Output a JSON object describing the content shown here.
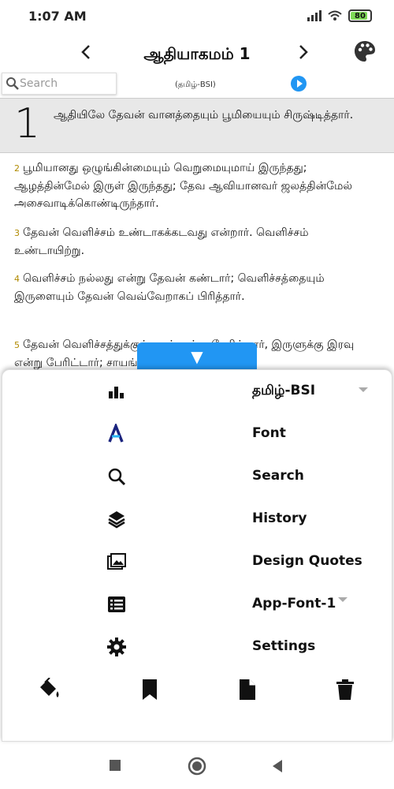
{
  "status": {
    "time": "1:07 AM",
    "battery": "80"
  },
  "header": {
    "title": "ஆதியாகமம் 1",
    "prev_icon": "chevron-left-icon",
    "next_icon": "chevron-right-icon",
    "palette_icon": "palette-icon"
  },
  "search": {
    "placeholder": "Search"
  },
  "version_label": "(தமிழ்-BSI)",
  "chapter_number": "1",
  "verses": [
    {
      "num": "",
      "text": "ஆதியிலே தேவன் வானத்தையும் பூமியையும் சிருஷ்டித்தார்."
    },
    {
      "num": "2",
      "text": "பூமியானது ஒழுங்கின்மையும் வெறுமையுமாய் இருந்தது; ஆழத்தின்மேல் இருள் இருந்தது; தேவ ஆவியானவர் ஜலத்தின்மேல் அசைவாடிக்கொண்டிருந்தார்."
    },
    {
      "num": "3",
      "text": "தேவன் வெளிச்சம் உண்டாகக்கடவது என்றார். வெளிச்சம் உண்டாயிற்று."
    },
    {
      "num": "4",
      "text": "வெளிச்சம் நல்லது என்று தேவன் கண்டார்; வெளிச்சத்தையும் இருளையும் தேவன் வெவ்வேறாகப் பிரித்தார்."
    },
    {
      "num": "5",
      "text": "தேவன் வெளிச்சத்துக்குப் பகல் என்று பேரிட்டார், இருளுக்கு இரவு என்று பேரிட்டார்; சாயங்காலமும்"
    }
  ],
  "sheet": {
    "toggle_glyph": "▼",
    "menu": [
      {
        "label": "தமிழ்-BSI",
        "icon": "bar-chart-icon"
      },
      {
        "label": "Font",
        "icon": "font-icon"
      },
      {
        "label": "Search",
        "icon": "search-icon"
      },
      {
        "label": "History",
        "icon": "layers-icon"
      },
      {
        "label": "Design Quotes",
        "icon": "image-icon"
      },
      {
        "label": "App-Font-1",
        "icon": "list-icon"
      },
      {
        "label": "Settings",
        "icon": "gear-icon"
      }
    ],
    "toolbar": [
      "paint-bucket-icon",
      "bookmark-icon",
      "document-icon",
      "trash-icon"
    ]
  },
  "colors": {
    "accent": "#2196f3",
    "verse_number": "#b08a00",
    "highlight_bg": "#e8e8e8"
  }
}
